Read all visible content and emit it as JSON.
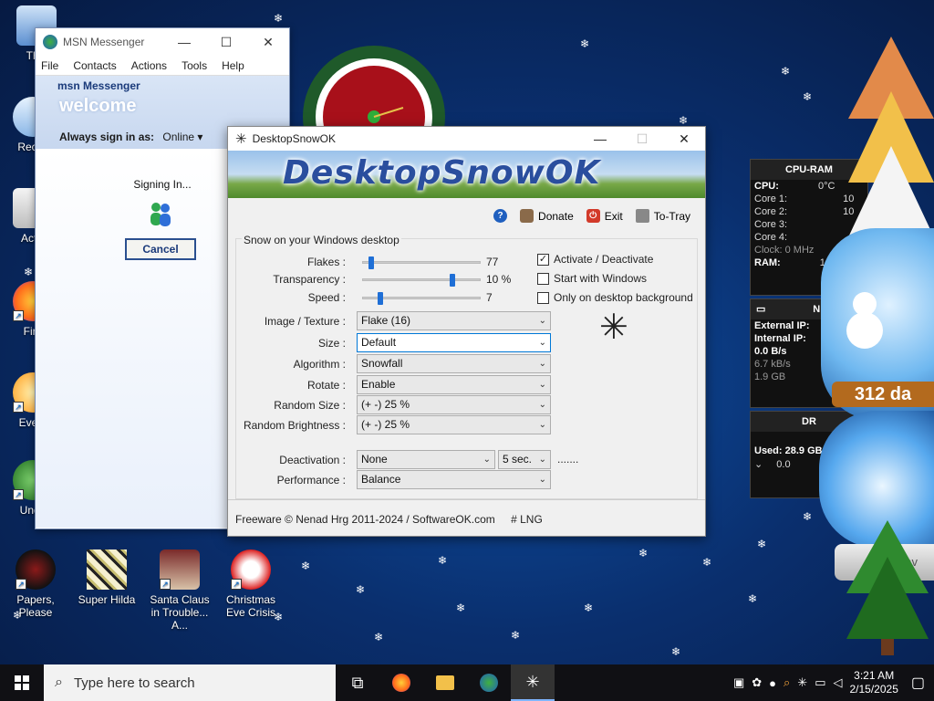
{
  "desktop_icons": [
    {
      "label": "This",
      "icon": "computer-icon"
    },
    {
      "label": "Recyc",
      "icon": "recycle-bin-icon"
    },
    {
      "label": "Activ",
      "icon": "folder-icon"
    },
    {
      "label": "Fire",
      "icon": "firefox-icon"
    },
    {
      "label": "Every",
      "icon": "search-app-icon"
    },
    {
      "label": "Unde",
      "icon": "game-icon"
    },
    {
      "label": "Papers, Please",
      "icon": "papers-please-icon"
    },
    {
      "label": "Super Hilda",
      "icon": "super-hilda-icon"
    },
    {
      "label": "Santa Claus in Trouble... A...",
      "icon": "santa-game-icon"
    },
    {
      "label": "Christmas Eve Crisis",
      "icon": "christmas-game-icon"
    }
  ],
  "msn": {
    "title": "MSN Messenger",
    "menu": [
      "File",
      "Contacts",
      "Actions",
      "Tools",
      "Help"
    ],
    "brand": "msn Messenger",
    "welcome": "welcome",
    "always_sign_in_label": "Always sign in as:",
    "status": "Online",
    "signing_in": "Signing In...",
    "cancel": "Cancel"
  },
  "snow": {
    "title": "DesktopSnowOK",
    "hero_text": "DesktopSnowOK",
    "toolbar": {
      "help": "?",
      "donate": "Donate",
      "exit": "Exit",
      "to_tray": "To-Tray"
    },
    "group_title": "Snow on your Windows desktop",
    "flakes": {
      "label": "Flakes :",
      "value": "77",
      "level": 0.05
    },
    "transparency": {
      "label": "Transparency :",
      "value": "10 %",
      "level": 0.78
    },
    "speed": {
      "label": "Speed :",
      "value": "7",
      "level": 0.13
    },
    "checks": {
      "activate": {
        "label": "Activate / Deactivate",
        "checked": true
      },
      "start": {
        "label": "Start with Windows",
        "checked": false
      },
      "only_desktop": {
        "label": "Only on desktop background",
        "checked": false
      }
    },
    "image_texture": {
      "label": "Image / Texture :",
      "value": "Flake (16)"
    },
    "size": {
      "label": "Size :",
      "value": "Default"
    },
    "algorithm": {
      "label": "Algorithm :",
      "value": "Snowfall"
    },
    "rotate": {
      "label": "Rotate :",
      "value": "Enable"
    },
    "random_size": {
      "label": "Random Size :",
      "value": "(+ -) 25 %"
    },
    "random_brightness": {
      "label": "Random Brightness :",
      "value": "(+ -) 25 %"
    },
    "deactivation": {
      "label": "Deactivation :",
      "value": "None",
      "time": "5 sec.",
      "more": "......."
    },
    "performance": {
      "label": "Performance :",
      "value": "Balance"
    },
    "footer": "Freeware © Nenad Hrg 2011-2024 / SoftwareOK.com",
    "lng": "# LNG"
  },
  "cpu_gadget": {
    "title": "CPU-RAM",
    "cpu_label": "CPU:",
    "cpu_temp": "0°C",
    "cores": [
      "Core 1:",
      "Core 2:",
      "Core 3:",
      "Core 4:"
    ],
    "core_values": [
      "10",
      "10"
    ],
    "clock": "Clock: 0 MHz",
    "ram_label": "RAM:",
    "ram_value": "1.6 GB"
  },
  "net_gadget": {
    "title": "N",
    "external_ip": "External IP:",
    "internal_ip": "Internal IP:",
    "speed": "0.0 B/s",
    "kbs": "6.7 kB/s",
    "gb": "1.9 GB"
  },
  "drive_gadget": {
    "title": "DR",
    "used": "Used: 28.9 GB",
    "value": "0.0"
  },
  "globe": {
    "days": "312 da",
    "sub": "dav"
  },
  "taskbar": {
    "search_placeholder": "Type here to search",
    "time": "3:21 AM",
    "date": "2/15/2025"
  },
  "colors": {
    "accent": "#0078d7",
    "desktop": "#0a2f6e",
    "taskbar": "#101014"
  }
}
